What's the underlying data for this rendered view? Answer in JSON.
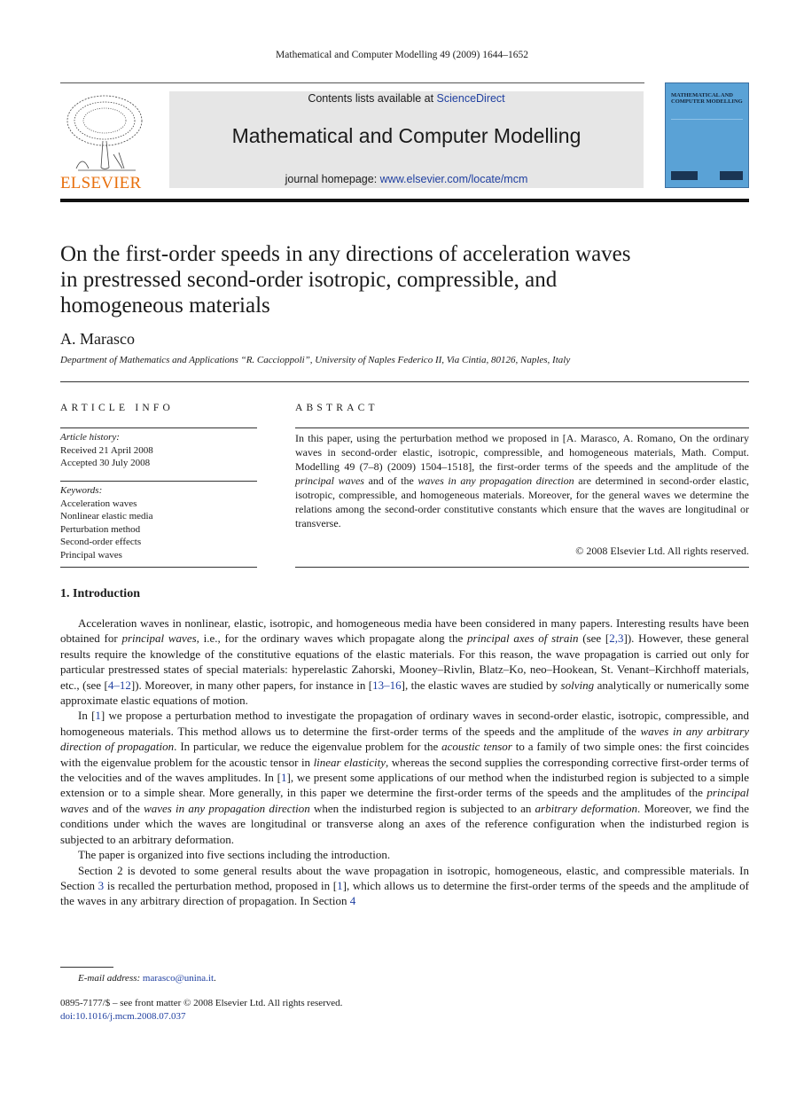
{
  "running_head": "Mathematical and Computer Modelling 49 (2009) 1644–1652",
  "masthead": {
    "publisher": "ELSEVIER",
    "contents_prefix": "Contents lists available at ",
    "contents_link": "ScienceDirect",
    "journal_title": "Mathematical and Computer Modelling",
    "homepage_prefix": "journal homepage: ",
    "homepage_link": "www.elsevier.com/locate/mcm",
    "cover_title": "MATHEMATICAL AND COMPUTER MODELLING",
    "colors": {
      "publisher": "#e8700e",
      "cover": "#5aa2d6",
      "link": "#1f3fa0",
      "masthead_bg": "#e6e6e6"
    }
  },
  "article": {
    "title_lines": [
      "On the first-order speeds in any directions of acceleration waves",
      "in prestressed second-order isotropic, compressible, and",
      "homogeneous materials"
    ],
    "author": "A. Marasco",
    "affiliation": "Department of Mathematics and Applications “R. Caccioppoli”, University of Naples Federico II, Via Cintia, 80126, Naples, Italy"
  },
  "article_info": {
    "heading": "ARTICLE INFO",
    "history_label": "Article history:",
    "received": "Received 21 April 2008",
    "accepted": "Accepted 30 July 2008",
    "keywords_label": "Keywords:",
    "keywords": [
      "Acceleration waves",
      "Nonlinear elastic media",
      "Perturbation method",
      "Second-order effects",
      "Principal waves"
    ]
  },
  "abstract": {
    "heading": "ABSTRACT",
    "parts": {
      "p1": "In this paper, using the perturbation method we proposed in [A. Marasco, A. Romano, On the ordinary waves in second-order elastic, isotropic, compressible, and homogeneous materials, Math. Comput. Modelling 49 (7–8) (2009) 1504–1518], the first-order terms of the speeds and the amplitude of the ",
      "i1": "principal waves",
      "p2": " and of the ",
      "i2": "waves in any propagation direction",
      "p3": " are determined in second-order elastic, isotropic, compressible, and homogeneous materials. Moreover, for the general waves we determine the relations among the second-order constitutive constants which ensure that the waves are longitudinal or transverse."
    },
    "copyright": "© 2008 Elsevier Ltd. All rights reserved."
  },
  "introduction": {
    "heading": "1.  Introduction",
    "p1": {
      "a": "Acceleration waves in nonlinear, elastic, isotropic, and homogeneous media have been considered in many papers. Interesting results have been obtained for ",
      "b": "principal waves",
      "c": ", i.e., for the ordinary waves which propagate along the ",
      "d": "principal axes of strain",
      "e": " (see [",
      "ref1": "2,3",
      "f": "]). However, these general results require the knowledge of the constitutive equations of the elastic materials. For this reason, the wave propagation is carried out only for particular prestressed states of special materials: hyperelastic Zahorski, Mooney–Rivlin, Blatz–Ko, neo–Hookean, St. Venant–Kirchhoff materials, etc., (see [",
      "ref2": "4–12",
      "g": "]). Moreover, in many other papers, for instance in [",
      "ref3": "13–16",
      "h": "], the elastic waves are studied by ",
      "i": "solving",
      "j": " analytically or numerically some approximate elastic equations of motion."
    },
    "p2": {
      "a": "In [",
      "ref1": "1",
      "b": "] we propose a perturbation method to investigate the propagation of ordinary waves in second-order elastic, isotropic, compressible, and homogeneous materials. This method allows us to determine the first-order terms of the speeds and the amplitude of the ",
      "c": "waves in any arbitrary direction of propagation",
      "d": ". In particular, we reduce the eigenvalue problem for the ",
      "e": "acoustic tensor",
      "f": " to a family of two simple ones: the first coincides with the eigenvalue problem for the acoustic tensor in ",
      "g": "linear elasticity",
      "h": ", whereas the second supplies the corresponding corrective first-order terms of the velocities and of the waves amplitudes. In [",
      "ref2": "1",
      "i": "], we present some applications of our method when the indisturbed region is subjected to a simple extension or to a simple shear. More generally, in this paper we determine the first-order terms of the speeds and the amplitudes of the ",
      "j": "principal waves",
      "k": " and of the ",
      "l": "waves in any propagation direction",
      "m": " when the indisturbed region is subjected to an ",
      "n": "arbitrary deformation",
      "o": ". Moreover, we find the conditions under which the waves are longitudinal or transverse along an axes of the reference configuration when the indisturbed region is subjected to an arbitrary deformation."
    },
    "p3": "The paper is organized into five sections including the introduction.",
    "p4": {
      "a": "Section 2 is devoted to some general results about the wave propagation in isotropic, homogeneous, elastic, and compressible materials. In Section ",
      "ref1": "3",
      "b": " is recalled the perturbation method, proposed in [",
      "ref2": "1",
      "c": "], which allows us to determine the first-order terms of the speeds and the amplitude of the waves in any arbitrary direction of propagation. In Section ",
      "ref3": "4"
    }
  },
  "footnote": {
    "label": "E-mail address: ",
    "email": "marasco@unina.it",
    "suffix": "."
  },
  "front_matter": {
    "issn_line": "0895-7177/$ – see front matter © 2008 Elsevier Ltd. All rights reserved.",
    "doi": "doi:10.1016/j.mcm.2008.07.037"
  }
}
